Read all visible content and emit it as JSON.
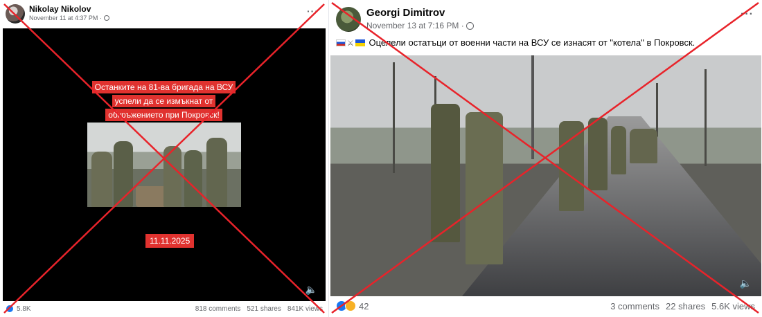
{
  "post_left": {
    "author": "Nikolay Nikolov",
    "timestamp": "November 11 at 4:37 PM · ",
    "more_label": "···",
    "overlay_lines": [
      "Останките на 81-ва бригада на ВСУ",
      "успели да се измъкнат  от",
      "обкръжението при Покровск!"
    ],
    "date_tag": "11.11.2025",
    "reactions": "5.8K",
    "comments": "818 comments",
    "shares": "521 shares",
    "views": "841K views"
  },
  "post_right": {
    "author": "Georgi Dimitrov",
    "timestamp": "November 13 at 7:16 PM · ",
    "more_label": "···",
    "caption": "Оцелели остатъци от военни части на ВСУ се изнасят от \"котела\" в Покровск.",
    "reactions": "42",
    "comments": "3 comments",
    "shares": "22 shares",
    "views": "5.6K views"
  },
  "colors": {
    "cross": "#e8232a",
    "tag": "#e0322f",
    "like": "#1877f2"
  },
  "icons": [
    "globe-icon",
    "more-icon",
    "speaker-icon",
    "like-reaction-icon",
    "haha-reaction-icon"
  ]
}
